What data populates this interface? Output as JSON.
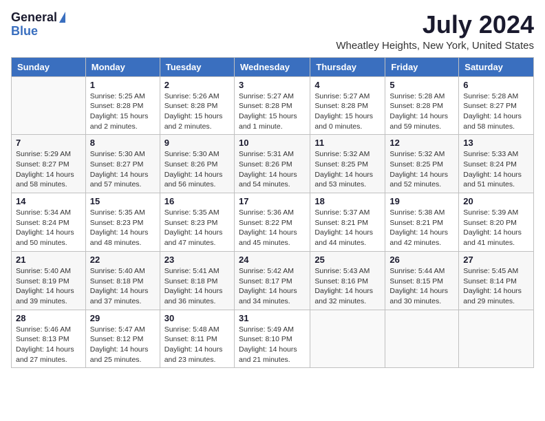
{
  "logo": {
    "general": "General",
    "blue": "Blue"
  },
  "title": "July 2024",
  "location": "Wheatley Heights, New York, United States",
  "weekdays": [
    "Sunday",
    "Monday",
    "Tuesday",
    "Wednesday",
    "Thursday",
    "Friday",
    "Saturday"
  ],
  "weeks": [
    [
      {
        "day": "",
        "info": ""
      },
      {
        "day": "1",
        "info": "Sunrise: 5:25 AM\nSunset: 8:28 PM\nDaylight: 15 hours\nand 2 minutes."
      },
      {
        "day": "2",
        "info": "Sunrise: 5:26 AM\nSunset: 8:28 PM\nDaylight: 15 hours\nand 2 minutes."
      },
      {
        "day": "3",
        "info": "Sunrise: 5:27 AM\nSunset: 8:28 PM\nDaylight: 15 hours\nand 1 minute."
      },
      {
        "day": "4",
        "info": "Sunrise: 5:27 AM\nSunset: 8:28 PM\nDaylight: 15 hours\nand 0 minutes."
      },
      {
        "day": "5",
        "info": "Sunrise: 5:28 AM\nSunset: 8:28 PM\nDaylight: 14 hours\nand 59 minutes."
      },
      {
        "day": "6",
        "info": "Sunrise: 5:28 AM\nSunset: 8:27 PM\nDaylight: 14 hours\nand 58 minutes."
      }
    ],
    [
      {
        "day": "7",
        "info": "Sunrise: 5:29 AM\nSunset: 8:27 PM\nDaylight: 14 hours\nand 58 minutes."
      },
      {
        "day": "8",
        "info": "Sunrise: 5:30 AM\nSunset: 8:27 PM\nDaylight: 14 hours\nand 57 minutes."
      },
      {
        "day": "9",
        "info": "Sunrise: 5:30 AM\nSunset: 8:26 PM\nDaylight: 14 hours\nand 56 minutes."
      },
      {
        "day": "10",
        "info": "Sunrise: 5:31 AM\nSunset: 8:26 PM\nDaylight: 14 hours\nand 54 minutes."
      },
      {
        "day": "11",
        "info": "Sunrise: 5:32 AM\nSunset: 8:25 PM\nDaylight: 14 hours\nand 53 minutes."
      },
      {
        "day": "12",
        "info": "Sunrise: 5:32 AM\nSunset: 8:25 PM\nDaylight: 14 hours\nand 52 minutes."
      },
      {
        "day": "13",
        "info": "Sunrise: 5:33 AM\nSunset: 8:24 PM\nDaylight: 14 hours\nand 51 minutes."
      }
    ],
    [
      {
        "day": "14",
        "info": "Sunrise: 5:34 AM\nSunset: 8:24 PM\nDaylight: 14 hours\nand 50 minutes."
      },
      {
        "day": "15",
        "info": "Sunrise: 5:35 AM\nSunset: 8:23 PM\nDaylight: 14 hours\nand 48 minutes."
      },
      {
        "day": "16",
        "info": "Sunrise: 5:35 AM\nSunset: 8:23 PM\nDaylight: 14 hours\nand 47 minutes."
      },
      {
        "day": "17",
        "info": "Sunrise: 5:36 AM\nSunset: 8:22 PM\nDaylight: 14 hours\nand 45 minutes."
      },
      {
        "day": "18",
        "info": "Sunrise: 5:37 AM\nSunset: 8:21 PM\nDaylight: 14 hours\nand 44 minutes."
      },
      {
        "day": "19",
        "info": "Sunrise: 5:38 AM\nSunset: 8:21 PM\nDaylight: 14 hours\nand 42 minutes."
      },
      {
        "day": "20",
        "info": "Sunrise: 5:39 AM\nSunset: 8:20 PM\nDaylight: 14 hours\nand 41 minutes."
      }
    ],
    [
      {
        "day": "21",
        "info": "Sunrise: 5:40 AM\nSunset: 8:19 PM\nDaylight: 14 hours\nand 39 minutes."
      },
      {
        "day": "22",
        "info": "Sunrise: 5:40 AM\nSunset: 8:18 PM\nDaylight: 14 hours\nand 37 minutes."
      },
      {
        "day": "23",
        "info": "Sunrise: 5:41 AM\nSunset: 8:18 PM\nDaylight: 14 hours\nand 36 minutes."
      },
      {
        "day": "24",
        "info": "Sunrise: 5:42 AM\nSunset: 8:17 PM\nDaylight: 14 hours\nand 34 minutes."
      },
      {
        "day": "25",
        "info": "Sunrise: 5:43 AM\nSunset: 8:16 PM\nDaylight: 14 hours\nand 32 minutes."
      },
      {
        "day": "26",
        "info": "Sunrise: 5:44 AM\nSunset: 8:15 PM\nDaylight: 14 hours\nand 30 minutes."
      },
      {
        "day": "27",
        "info": "Sunrise: 5:45 AM\nSunset: 8:14 PM\nDaylight: 14 hours\nand 29 minutes."
      }
    ],
    [
      {
        "day": "28",
        "info": "Sunrise: 5:46 AM\nSunset: 8:13 PM\nDaylight: 14 hours\nand 27 minutes."
      },
      {
        "day": "29",
        "info": "Sunrise: 5:47 AM\nSunset: 8:12 PM\nDaylight: 14 hours\nand 25 minutes."
      },
      {
        "day": "30",
        "info": "Sunrise: 5:48 AM\nSunset: 8:11 PM\nDaylight: 14 hours\nand 23 minutes."
      },
      {
        "day": "31",
        "info": "Sunrise: 5:49 AM\nSunset: 8:10 PM\nDaylight: 14 hours\nand 21 minutes."
      },
      {
        "day": "",
        "info": ""
      },
      {
        "day": "",
        "info": ""
      },
      {
        "day": "",
        "info": ""
      }
    ]
  ]
}
